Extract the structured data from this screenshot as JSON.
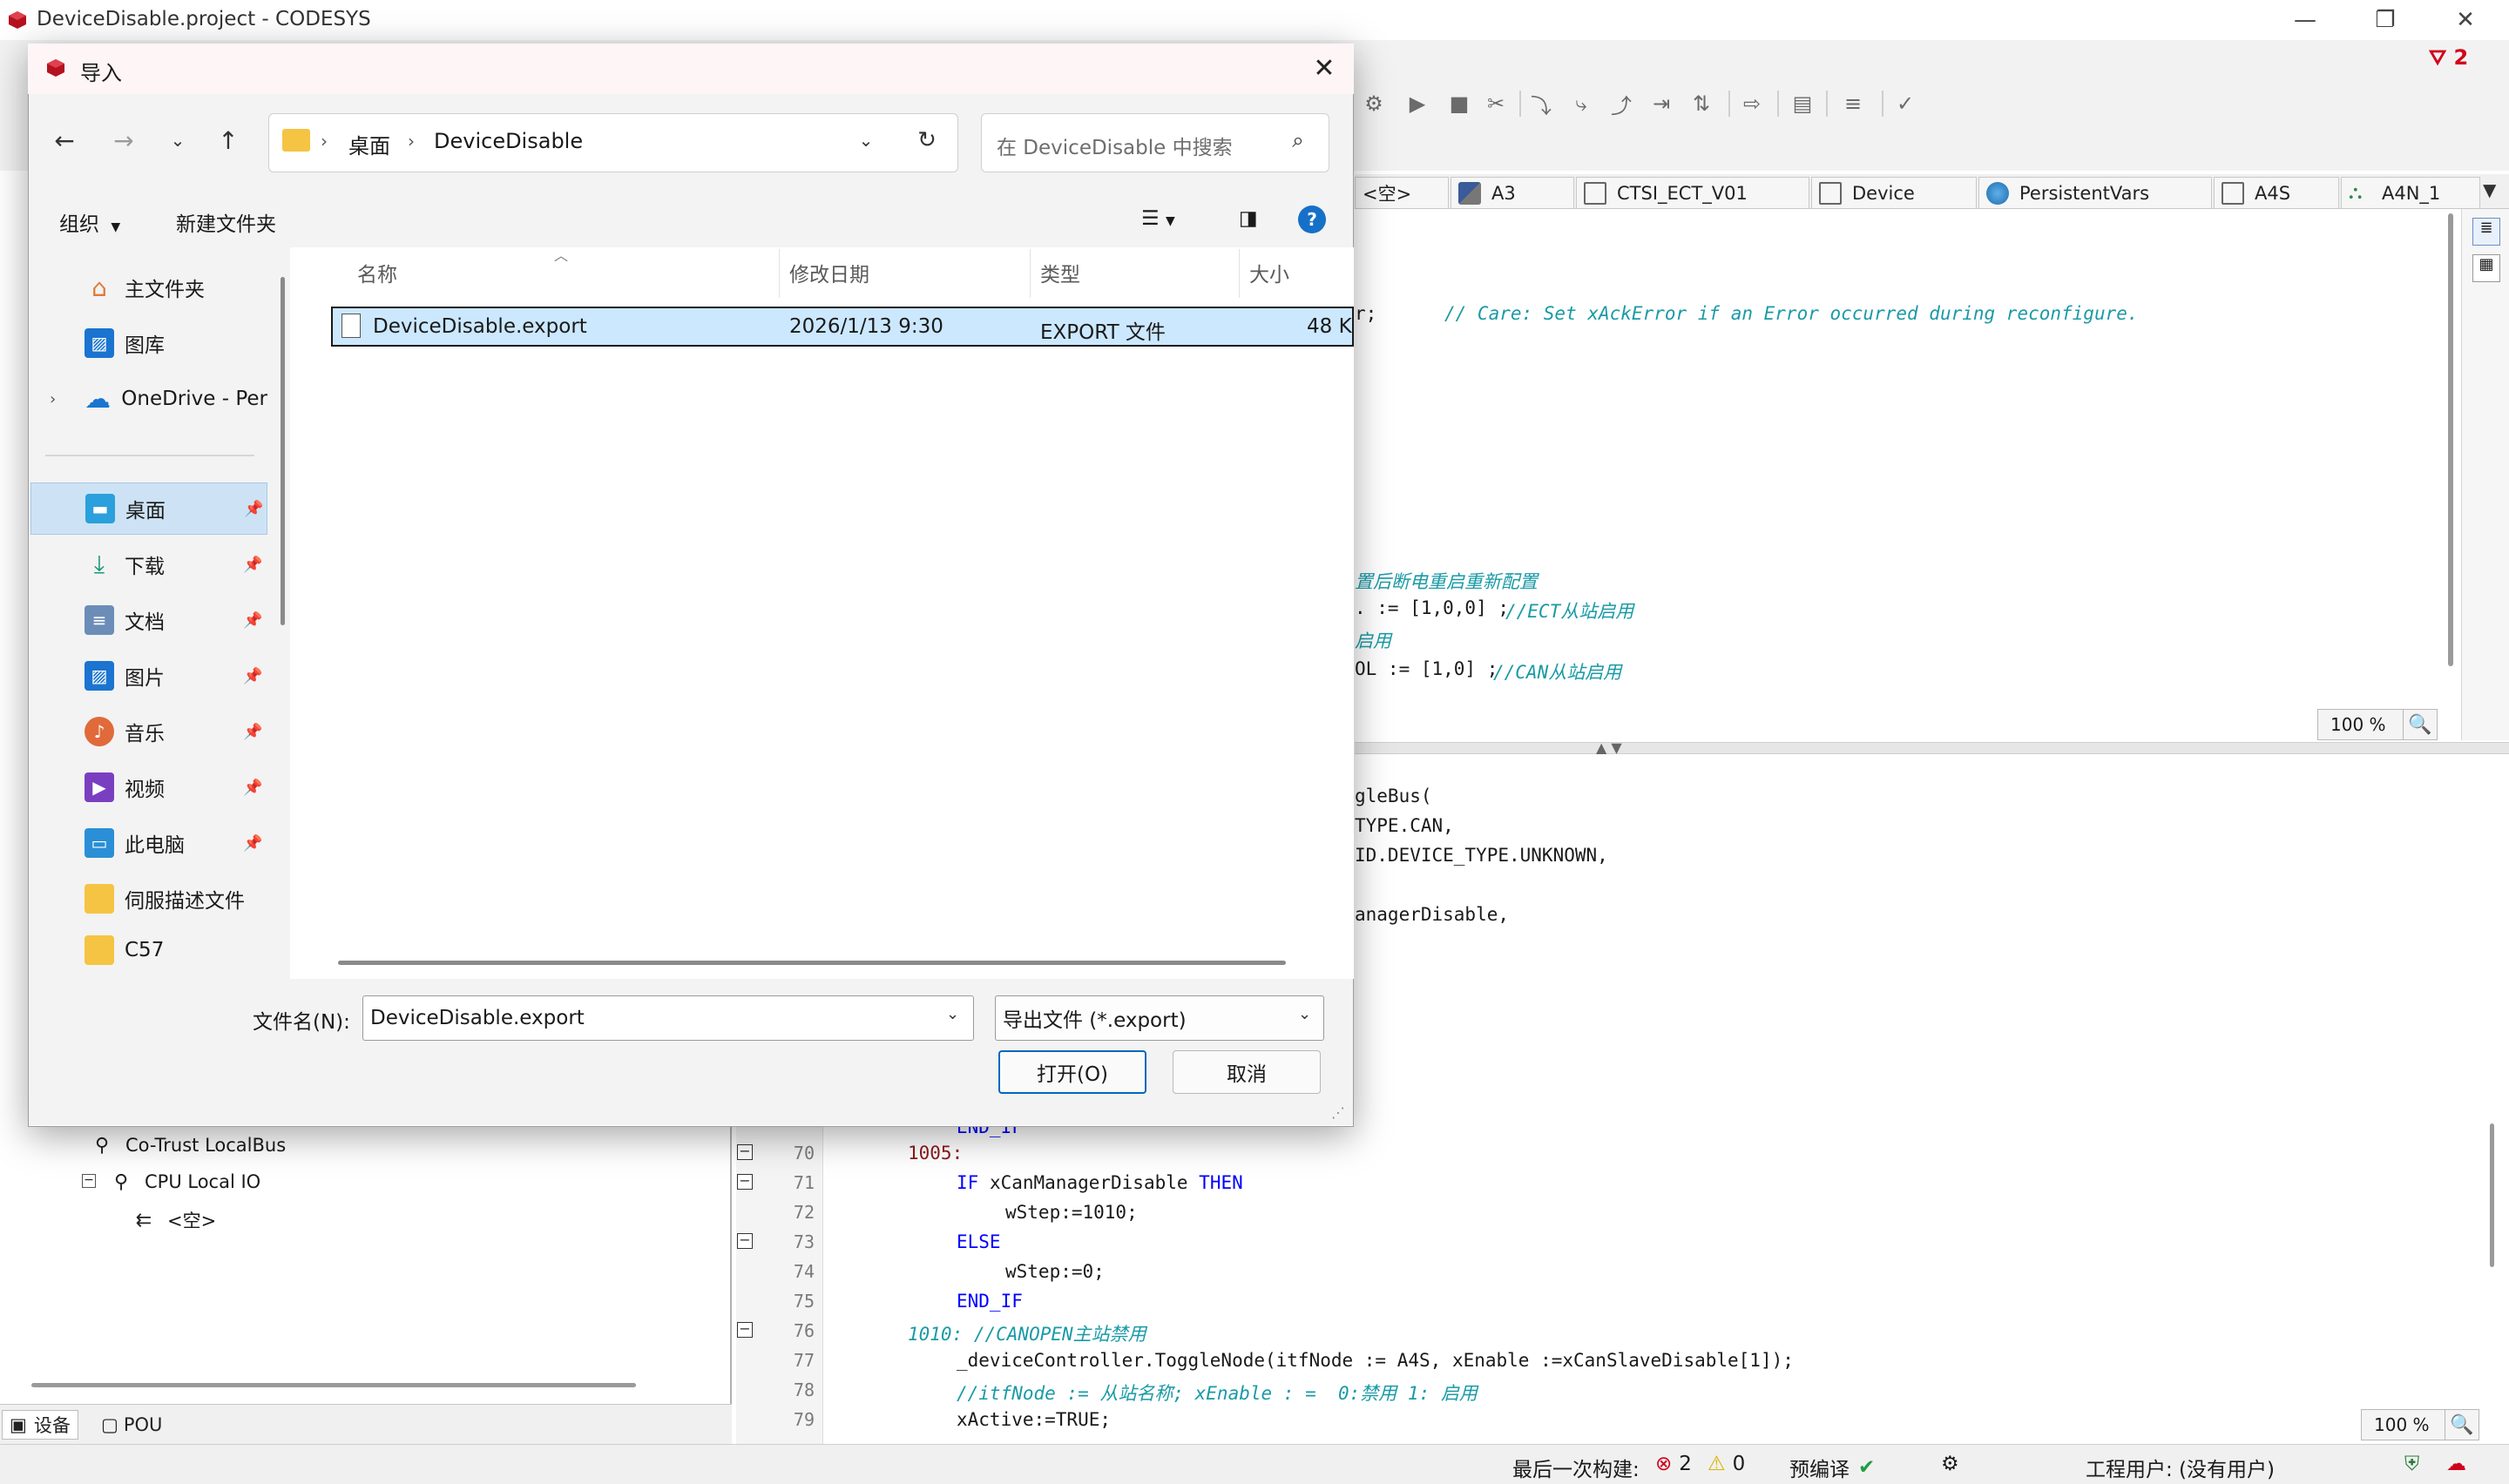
{
  "app": {
    "title": "DeviceDisable.project - CODESYS",
    "minimize": "—",
    "maximize": "❐",
    "close": "✕",
    "error_count": "2"
  },
  "editor_tabs": [
    {
      "label": "<空>"
    },
    {
      "label": "A3"
    },
    {
      "label": "CTSI_ECT_V01"
    },
    {
      "label": "Device"
    },
    {
      "label": "PersistentVars"
    },
    {
      "label": "A4S"
    },
    {
      "label": "A4N_1"
    }
  ],
  "editor_top": {
    "lines": [
      {
        "code": "r;",
        "comment": "// Care: Set xAckError if an Error occurred during reconfigure."
      },
      {
        "code": "",
        "comment": "置后断电重启重新配置"
      },
      {
        "code": ". := [1,0,0] ;",
        "comment": "//ECT从站启用"
      },
      {
        "code": "",
        "comment": "启用"
      },
      {
        "code": "OL := [1,0] ;",
        "comment": "//CAN从站启用"
      }
    ],
    "zoom": "100 %"
  },
  "editor_bottom": {
    "upper_lines": [
      "gleBus(",
      "TYPE.CAN,",
      "ID.DEVICE_TYPE.UNKNOWN,",
      "",
      "anagerDisable,"
    ],
    "cut_line": "END_IF",
    "numbered_lines": [
      {
        "n": "70",
        "text": "1005:",
        "fold": true
      },
      {
        "n": "71",
        "text": "IF xCanManagerDisable THEN",
        "fold": true
      },
      {
        "n": "72",
        "text": "wStep:=1010;",
        "fold": false
      },
      {
        "n": "73",
        "text": "ELSE",
        "fold": true
      },
      {
        "n": "74",
        "text": "wStep:=0;",
        "fold": false
      },
      {
        "n": "75",
        "text": "END_IF",
        "fold": false
      },
      {
        "n": "76",
        "text": "1010: //CANOPEN主站禁用",
        "fold": true
      },
      {
        "n": "77",
        "text": "_deviceController.ToggleNode(itfNode := A4S, xEnable :=xCanSlaveDisable[1]);",
        "fold": false
      },
      {
        "n": "78",
        "text": "//itfNode := 从站名称; xEnable : =  0:禁用 1: 启用",
        "fold": false
      },
      {
        "n": "79",
        "text": "xActive:=TRUE;",
        "fold": false
      }
    ],
    "zoom": "100 %"
  },
  "device_tree": {
    "items": [
      {
        "label": "Co-Trust LocalBus"
      },
      {
        "label": "CPU Local IO"
      },
      {
        "label": "<空>"
      }
    ],
    "tabs": [
      {
        "label": "设备"
      },
      {
        "label": "POU"
      }
    ]
  },
  "statusbar": {
    "last_build": "最后一次构建:",
    "errors": "2",
    "warnings": "0",
    "precompile": "预编译",
    "project_user": "工程用户: (没有用户)"
  },
  "dialog": {
    "title": "导入",
    "breadcrumb": [
      "桌面",
      "DeviceDisable"
    ],
    "search_placeholder": "在 DeviceDisable 中搜索",
    "organize": "组织",
    "new_folder": "新建文件夹",
    "nav_items": [
      {
        "label": "主文件夹",
        "icon": "home-icon",
        "pinned": false,
        "selected": false
      },
      {
        "label": "图库",
        "icon": "gallery-icon",
        "pinned": false,
        "selected": false
      },
      {
        "label": "OneDrive - Per",
        "icon": "onedrive-icon",
        "pinned": false,
        "selected": false
      },
      {
        "label": "桌面",
        "icon": "desktop-icon",
        "pinned": true,
        "selected": true
      },
      {
        "label": "下载",
        "icon": "download-icon",
        "pinned": true,
        "selected": false
      },
      {
        "label": "文档",
        "icon": "document-icon",
        "pinned": true,
        "selected": false
      },
      {
        "label": "图片",
        "icon": "pictures-icon",
        "pinned": true,
        "selected": false
      },
      {
        "label": "音乐",
        "icon": "music-icon",
        "pinned": true,
        "selected": false
      },
      {
        "label": "视频",
        "icon": "video-icon",
        "pinned": true,
        "selected": false
      },
      {
        "label": "此电脑",
        "icon": "computer-icon",
        "pinned": true,
        "selected": false
      },
      {
        "label": "伺服描述文件",
        "icon": "folder-icon",
        "pinned": false,
        "selected": false
      },
      {
        "label": "C57",
        "icon": "folder-icon",
        "pinned": false,
        "selected": false
      }
    ],
    "columns": {
      "name": "名称",
      "modified": "修改日期",
      "type": "类型",
      "size": "大小"
    },
    "files": [
      {
        "name": "DeviceDisable.export",
        "modified": "2026/1/13 9:30",
        "type": "EXPORT 文件",
        "size": "48 K"
      }
    ],
    "filename_label": "文件名(N):",
    "filename_value": "DeviceDisable.export",
    "filetype_value": "导出文件 (*.export)",
    "open_label": "打开(O)",
    "cancel_label": "取消"
  }
}
